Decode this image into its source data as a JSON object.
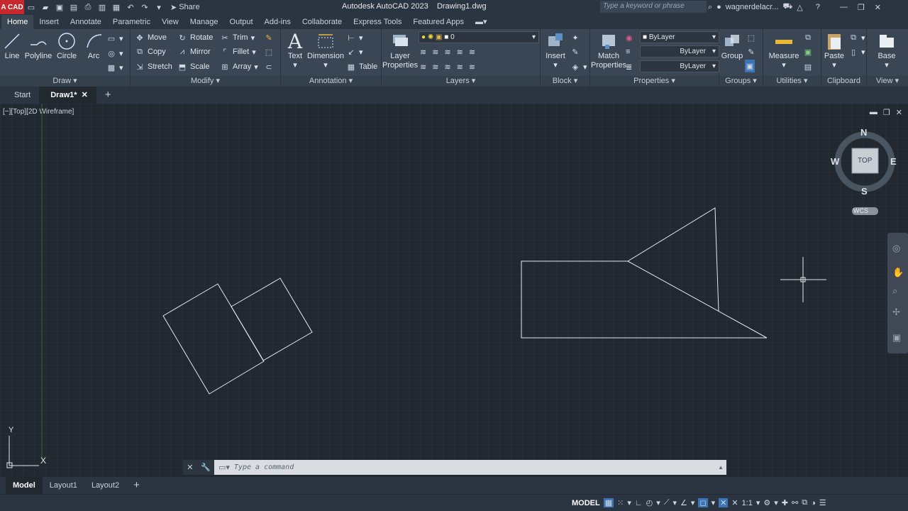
{
  "app": {
    "logo_text": "A CAD",
    "title": "Autodesk AutoCAD 2023",
    "filename": "Drawing1.dwg",
    "share_label": "Share",
    "search_placeholder": "Type a keyword or phrase",
    "username": "wagnerdelacr..."
  },
  "ribbon_tabs": [
    "Home",
    "Insert",
    "Annotate",
    "Parametric",
    "View",
    "Manage",
    "Output",
    "Add-ins",
    "Collaborate",
    "Express Tools",
    "Featured Apps"
  ],
  "panels": {
    "draw": {
      "title": "Draw",
      "line": "Line",
      "polyline": "Polyline",
      "circle": "Circle",
      "arc": "Arc"
    },
    "modify": {
      "title": "Modify",
      "move": "Move",
      "rotate": "Rotate",
      "trim": "Trim",
      "copy": "Copy",
      "mirror": "Mirror",
      "fillet": "Fillet",
      "stretch": "Stretch",
      "scale": "Scale",
      "array": "Array"
    },
    "annotation": {
      "title": "Annotation",
      "text": "Text",
      "dimension": "Dimension",
      "table": "Table"
    },
    "layers": {
      "title": "Layers",
      "layer_properties": "Layer Properties",
      "current_layer": "0"
    },
    "block": {
      "title": "Block",
      "insert": "Insert"
    },
    "properties": {
      "title": "Properties",
      "match": "Match Properties",
      "color": "ByLayer",
      "linetype": "ByLayer",
      "lineweight": "ByLayer"
    },
    "groups": {
      "title": "Groups",
      "group": "Group"
    },
    "utilities": {
      "title": "Utilities",
      "measure": "Measure"
    },
    "clipboard": {
      "title": "Clipboard",
      "paste": "Paste"
    },
    "view": {
      "title": "View",
      "base": "Base"
    }
  },
  "file_tabs": {
    "start": "Start",
    "current": "Draw1*"
  },
  "viewport": {
    "label": "[−][Top][2D Wireframe]"
  },
  "viewcube": {
    "n": "N",
    "s": "S",
    "e": "E",
    "w": "W",
    "face": "TOP",
    "ucs": "WCS"
  },
  "ucs_icon": {
    "x": "X",
    "y": "Y"
  },
  "command": {
    "placeholder": "Type a command"
  },
  "layout_tabs": [
    "Model",
    "Layout1",
    "Layout2"
  ],
  "status": {
    "model": "MODEL",
    "scale": "1:1"
  }
}
